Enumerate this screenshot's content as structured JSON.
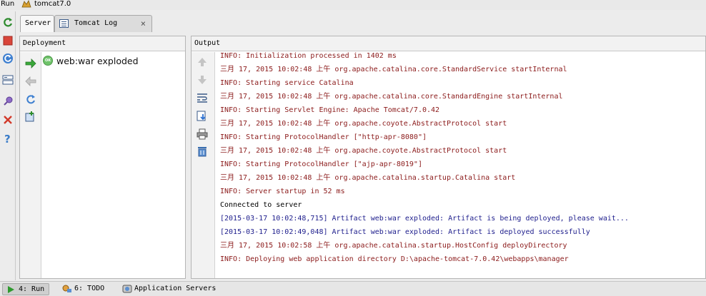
{
  "window": {
    "run_label": "Run",
    "config_name": "tomcat7.0"
  },
  "tabs": [
    {
      "label": "Server",
      "active": true
    },
    {
      "label": "Tomcat Log",
      "active": false,
      "close": "×"
    }
  ],
  "deployment": {
    "header": "Deployment",
    "items": [
      {
        "badge": "OK",
        "name": "web:war exploded"
      }
    ]
  },
  "output": {
    "header": "Output",
    "lines": [
      {
        "text": "INFO: Initialization processed in 1402 ms",
        "color": "#8b1a1a"
      },
      {
        "text": "三月 17, 2015 10:02:48 上午 org.apache.catalina.core.StandardService startInternal",
        "color": "#8b1a1a"
      },
      {
        "text": "INFO: Starting service Catalina",
        "color": "#8b1a1a"
      },
      {
        "text": "三月 17, 2015 10:02:48 上午 org.apache.catalina.core.StandardEngine startInternal",
        "color": "#8b1a1a"
      },
      {
        "text": "INFO: Starting Servlet Engine: Apache Tomcat/7.0.42",
        "color": "#8b1a1a"
      },
      {
        "text": "三月 17, 2015 10:02:48 上午 org.apache.coyote.AbstractProtocol start",
        "color": "#8b1a1a"
      },
      {
        "text": "INFO: Starting ProtocolHandler [\"http-apr-8080\"]",
        "color": "#8b1a1a"
      },
      {
        "text": "三月 17, 2015 10:02:48 上午 org.apache.coyote.AbstractProtocol start",
        "color": "#8b1a1a"
      },
      {
        "text": "INFO: Starting ProtocolHandler [\"ajp-apr-8019\"]",
        "color": "#8b1a1a"
      },
      {
        "text": "三月 17, 2015 10:02:48 上午 org.apache.catalina.startup.Catalina start",
        "color": "#8b1a1a"
      },
      {
        "text": "INFO: Server startup in 52 ms",
        "color": "#8b1a1a"
      },
      {
        "text": "Connected to server",
        "color": "#000000"
      },
      {
        "text": "[2015-03-17 10:02:48,715] Artifact web:war exploded: Artifact is being deployed, please wait...",
        "color": "#1d1d8c"
      },
      {
        "text": "[2015-03-17 10:02:49,048] Artifact web:war exploded: Artifact is deployed successfully",
        "color": "#1d1d8c"
      },
      {
        "text": "三月 17, 2015 10:02:58 上午 org.apache.catalina.startup.HostConfig deployDirectory",
        "color": "#8b1a1a"
      },
      {
        "text": "INFO: Deploying web application directory D:\\apache-tomcat-7.0.42\\webapps\\manager",
        "color": "#8b1a1a"
      }
    ]
  },
  "statusbar": {
    "run_tab": "4: Run",
    "todo_tab": "6: TODO",
    "app_servers_tab": "Application Servers"
  },
  "colors": {
    "log_red": "#8b1a1a",
    "log_blue": "#1d1d8c",
    "ok_green": "#6fc36a"
  }
}
